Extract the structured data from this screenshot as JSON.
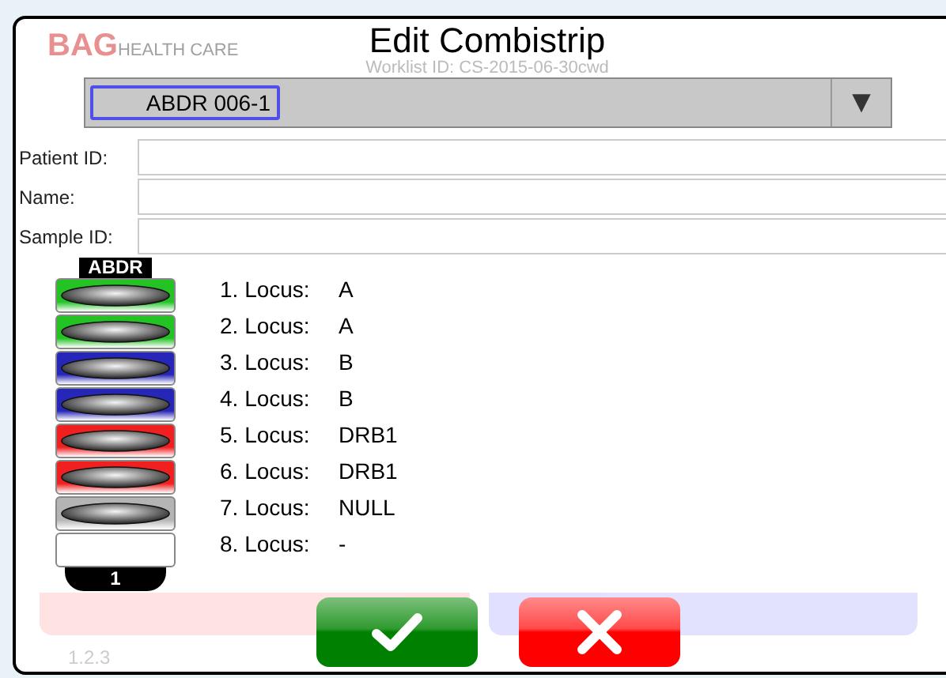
{
  "background": {
    "logo_brand": "BAG",
    "logo_sub": "HEALTH CARE",
    "worklist": "Worklist ID: CS-2015-06-30cwd",
    "footer_text": "1.2.3"
  },
  "dialog": {
    "title": "Edit Combistrip",
    "dropdown": {
      "value": "ABDR 006-1",
      "arrow": "▼"
    },
    "fields": [
      {
        "label": "Patient ID:"
      },
      {
        "label": "Name:"
      },
      {
        "label": "Sample ID:"
      }
    ],
    "strip": {
      "header": "ABDR",
      "footer": "1",
      "wells": [
        {
          "kind": "filled",
          "color": "#22c322"
        },
        {
          "kind": "filled",
          "color": "#22c322"
        },
        {
          "kind": "filled",
          "color": "#2626b8"
        },
        {
          "kind": "filled",
          "color": "#2626b8"
        },
        {
          "kind": "filled",
          "color": "#f02020"
        },
        {
          "kind": "filled",
          "color": "#f02020"
        },
        {
          "kind": "filled",
          "color": "#b4b4b4"
        },
        {
          "kind": "empty",
          "color": "#ffffff"
        }
      ]
    },
    "loci": [
      {
        "label": "1. Locus:",
        "value": "A"
      },
      {
        "label": "2. Locus:",
        "value": "A"
      },
      {
        "label": "3. Locus:",
        "value": "B"
      },
      {
        "label": "4. Locus:",
        "value": "B"
      },
      {
        "label": "5. Locus:",
        "value": "DRB1"
      },
      {
        "label": "6. Locus:",
        "value": "DRB1"
      },
      {
        "label": "7. Locus:",
        "value": "NULL"
      },
      {
        "label": "8. Locus:",
        "value": "-"
      }
    ],
    "buttons": [
      {
        "kind": "confirm"
      },
      {
        "kind": "cancel"
      }
    ]
  }
}
